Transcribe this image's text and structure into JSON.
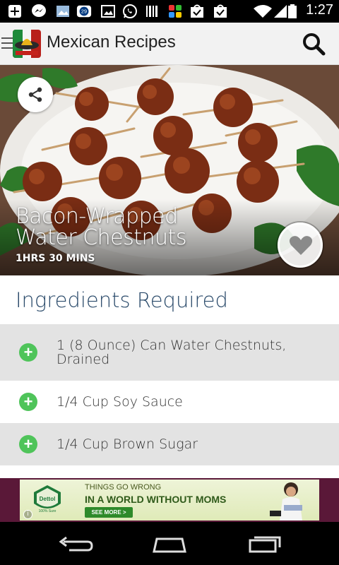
{
  "status_bar": {
    "time": "1:27",
    "icons": [
      "add-icon",
      "messenger-icon",
      "image-icon",
      "notification-29-icon",
      "gallery-icon",
      "whatsapp-icon",
      "barcode-icon",
      "pinwheel-icon",
      "check-bag-icon",
      "check-bag-icon",
      "wifi-icon",
      "signal-icon",
      "battery-icon"
    ],
    "badge": "29"
  },
  "app_bar": {
    "title": "Mexican Recipes",
    "icons": [
      "menu-icon",
      "app-logo",
      "search-icon"
    ]
  },
  "recipe": {
    "title_line1": "Bacon-Wrapped",
    "title_line2": "Water Chestnuts",
    "time": "1HRS 30 MINS",
    "actions": [
      "share-icon",
      "heart-icon"
    ]
  },
  "ingredients": {
    "heading": "Ingredients Required",
    "items": [
      {
        "line1": "1 (8  Ounce) Can  Water Chestnuts,",
        "line2": "Drained"
      },
      {
        "line1": "1/4 Cup   Soy Sauce",
        "line2": ""
      },
      {
        "line1": "1/4 Cup   Brown Sugar",
        "line2": ""
      }
    ]
  },
  "ad": {
    "brand": "Dettol",
    "brand_sub": "100% Sure",
    "line1": "THINGS GO WRONG",
    "line2": "IN A WORLD WITHOUT MOMS",
    "cta": "SEE MORE >",
    "info": "i"
  },
  "nav_bar": {
    "buttons": [
      "back-icon",
      "home-icon",
      "recents-icon"
    ]
  },
  "colors": {
    "accent_green": "#4fc45a",
    "heading_blue": "#2a4a6a",
    "row_grey": "#e3e3e3",
    "ad_frame": "#5a1838"
  }
}
